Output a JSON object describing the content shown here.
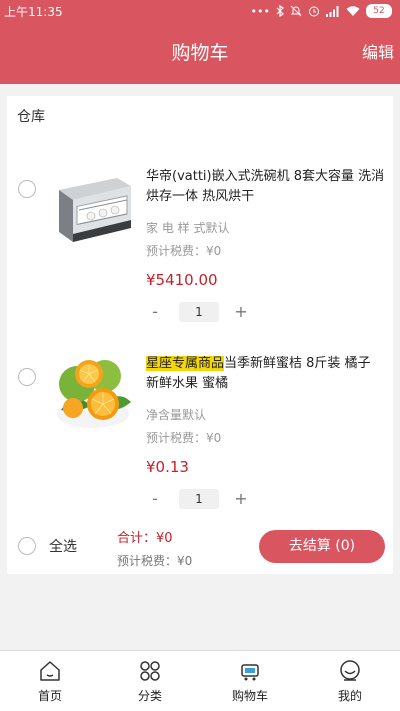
{
  "status_bar": {
    "time": "上午11:35",
    "battery": "52",
    "icons": [
      "more-dots-icon",
      "bluetooth-icon",
      "mute-icon",
      "alarm-icon",
      "signal-icon",
      "wifi-icon"
    ]
  },
  "header": {
    "title": "购物车",
    "edit_label": "编辑"
  },
  "cart": {
    "warehouse_label": "仓库",
    "items": [
      {
        "title": "华帝(vatti)嵌入式洗碗机 8套大容量 洗消烘存一体 热风烘干",
        "spec": "家 电 样 式默认",
        "tax": "预计税费：¥0",
        "price": "¥5410.00",
        "quantity": "1",
        "minus": "-",
        "plus": "+"
      },
      {
        "tag": "星座专属商品",
        "title": "当季新鲜蜜桔 8斤装 橘子 新鲜水果 蜜橘",
        "spec": "净含量默认",
        "tax": "预计税费：¥0",
        "price": "¥0.13",
        "quantity": "1",
        "minus": "-",
        "plus": "+"
      }
    ]
  },
  "footer": {
    "select_all": "全选",
    "total": "合计：¥0",
    "total_tax": "预计税费：¥0",
    "checkout": "去结算 (0)"
  },
  "tabs": [
    {
      "label": "首页",
      "icon": "home-icon"
    },
    {
      "label": "分类",
      "icon": "category-icon"
    },
    {
      "label": "购物车",
      "icon": "cart-icon"
    },
    {
      "label": "我的",
      "icon": "profile-icon"
    }
  ],
  "colors": {
    "brand": "#d9555f",
    "price": "#c8202b",
    "tag_highlight": "#f5d60b"
  }
}
